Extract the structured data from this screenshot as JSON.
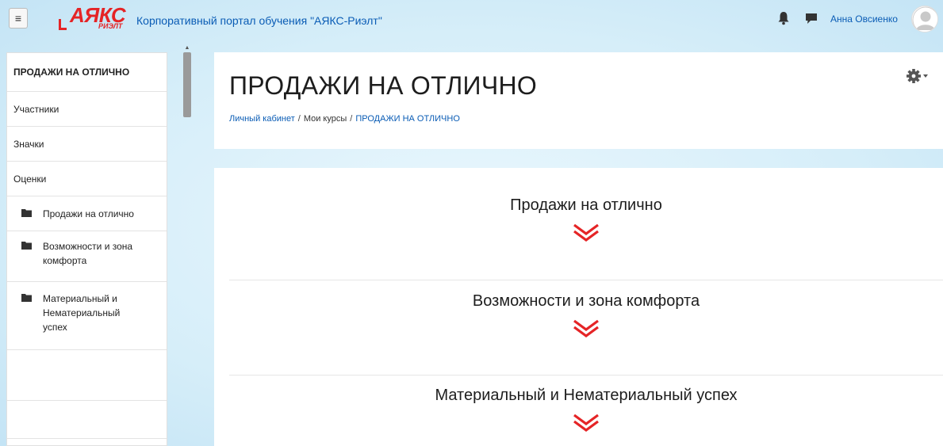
{
  "navbar": {
    "menu_icon": "hamburger-icon",
    "logo_text": "АЯКС",
    "logo_sub": "РИЭЛТ",
    "site_name": "Корпоративный портал обучения \"АЯКС-Риэлт\"",
    "bell_icon": "bell-icon",
    "chat_icon": "chat-icon",
    "user_name": "Анна Овсиенко"
  },
  "sidebar": {
    "title": "ПРОДАЖИ НА ОТЛИЧНО",
    "items": [
      {
        "label": "Участники"
      },
      {
        "label": "Значки"
      },
      {
        "label": "Оценки"
      }
    ],
    "folders": [
      {
        "label": "Продажи на отлично"
      },
      {
        "label": "Возможности и зона комфорта"
      },
      {
        "label": "Материальный и Нематериальный успех"
      }
    ]
  },
  "header": {
    "title": "ПРОДАЖИ НА ОТЛИЧНО",
    "breadcrumb": [
      {
        "label": "Личный кабинет"
      },
      {
        "label": "Мои курсы"
      },
      {
        "label": "ПРОДАЖИ НА ОТЛИЧНО"
      }
    ],
    "separator": "/"
  },
  "content": {
    "sections": [
      {
        "title": "Продажи на отлично"
      },
      {
        "title": "Возможности и зона комфорта"
      },
      {
        "title": "Материальный и Нематериальный успех"
      }
    ]
  },
  "colors": {
    "brand_red": "#e52426",
    "link_blue": "#0a5cb5"
  }
}
